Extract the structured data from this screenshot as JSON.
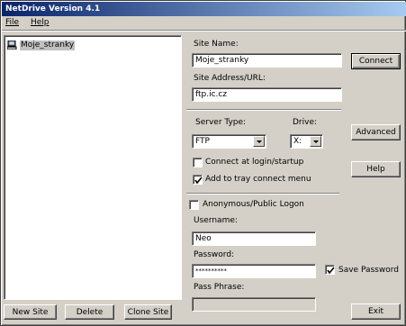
{
  "window": {
    "title": "NetDrive Version 4.1"
  },
  "menu": {
    "file": "File",
    "help": "Help"
  },
  "sites": [
    {
      "label": "Moje_stranky"
    }
  ],
  "left_buttons": {
    "new_site": "New Site",
    "delete": "Delete",
    "clone_site": "Clone Site"
  },
  "form": {
    "site_name_label": "Site Name:",
    "site_name_value": "Moje_stranky",
    "site_address_label": "Site Address/URL:",
    "site_address_value": "ftp.ic.cz",
    "server_type_label": "Server Type:",
    "server_type_value": "FTP",
    "drive_label": "Drive:",
    "drive_value": "X:",
    "connect_login_label": "Connect at login/startup",
    "connect_login_checked": false,
    "tray_menu_label": "Add to tray connect menu",
    "tray_menu_checked": true,
    "anonymous_label": "Anonymous/Public Logon",
    "anonymous_checked": false,
    "username_label": "Username:",
    "username_value": "Neo",
    "password_label": "Password:",
    "password_value": "**********",
    "save_password_label": "Save Password",
    "save_password_checked": true,
    "pass_phrase_label": "Pass Phrase:",
    "pass_phrase_value": ""
  },
  "right_buttons": {
    "connect": "Connect",
    "advanced": "Advanced",
    "help": "Help",
    "exit": "Exit"
  }
}
